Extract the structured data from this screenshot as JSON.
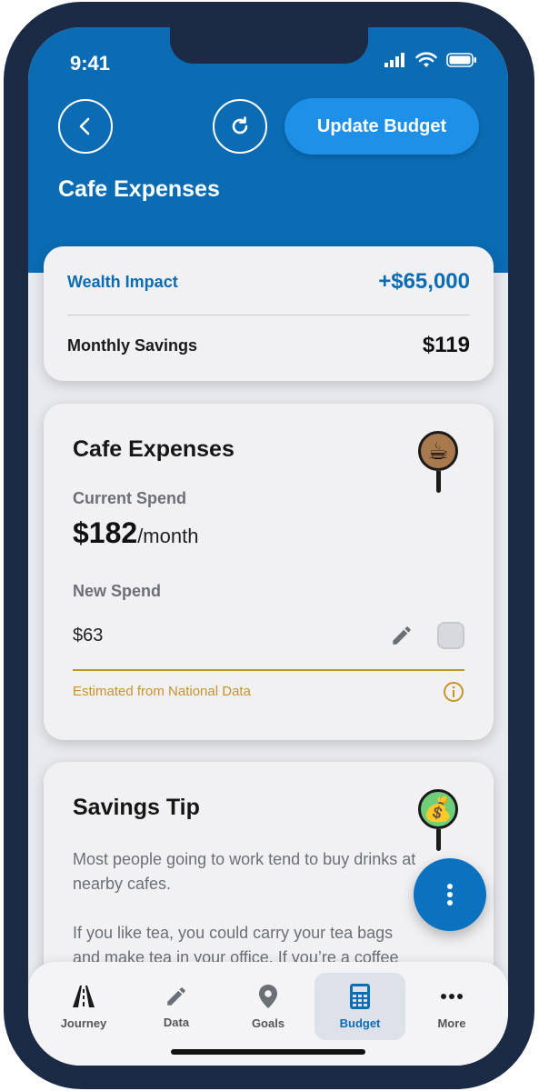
{
  "status": {
    "time": "9:41"
  },
  "header": {
    "update_button": "Update Budget",
    "title": "Cafe Expenses"
  },
  "impact": {
    "wealth_label": "Wealth Impact",
    "wealth_value": "+$65,000",
    "savings_label": "Monthly Savings",
    "savings_value": "$119"
  },
  "cafe": {
    "title": "Cafe Expenses",
    "current_label": "Current Spend",
    "current_value": "$182",
    "current_unit": "/month",
    "new_label": "New Spend",
    "new_value": "$63",
    "estimate_note": "Estimated from National Data",
    "icon_emoji": "☕"
  },
  "tip": {
    "title": "Savings Tip",
    "para1": "Most people going to work tend to buy drinks at nearby cafes.",
    "para2": "If you like tea, you could carry your tea bags and make tea in your office. If you’re a coffee",
    "icon_emoji": "💰"
  },
  "nav": {
    "items": [
      {
        "label": "Journey",
        "icon": "road-icon"
      },
      {
        "label": "Data",
        "icon": "pencil-icon"
      },
      {
        "label": "Goals",
        "icon": "map-pin-icon"
      },
      {
        "label": "Budget",
        "icon": "calculator-icon"
      },
      {
        "label": "More",
        "icon": "more-horizontal-icon"
      }
    ],
    "active": "Budget"
  },
  "colors": {
    "brand_blue": "#0b6bb3",
    "button_blue": "#1e90e8",
    "estimate_gold": "#c8922a"
  }
}
